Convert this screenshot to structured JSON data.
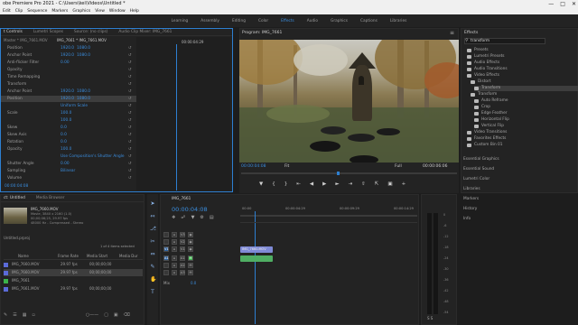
{
  "titlebar": {
    "title": "obe Premiere Pro 2021 - C:\\Users\\kei\\Videos\\Untitled *"
  },
  "menubar": {
    "items": [
      "Edit",
      "Clip",
      "Sequence",
      "Markers",
      "Graphics",
      "View",
      "Window",
      "Help"
    ]
  },
  "workspaces": {
    "items": [
      "Learning",
      "Assembly",
      "Editing",
      "Color",
      "Effects",
      "Audio",
      "Graphics",
      "Captions",
      "Libraries"
    ],
    "active": "Effects"
  },
  "effect_controls": {
    "tabs": [
      "t Controls",
      "Lumetri Scopes",
      "Source: (no clips)",
      "Audio Clip Mixer: IMG_7661"
    ],
    "master": "Master * IMG_7661.MOV",
    "seq": "IMG_7661 * IMG_7661.MOV",
    "timecode": "00:00:04:29",
    "params": [
      {
        "label": "Position",
        "v1": "1920.0",
        "v2": "1080.0"
      },
      {
        "label": "Anchor Point",
        "v1": "1920.0",
        "v2": "1080.0"
      },
      {
        "label": "Anti-flicker Filter",
        "v1": "0.00",
        "v2": ""
      },
      {
        "label": "Opacity",
        "v1": "",
        "v2": ""
      },
      {
        "label": "Time Remapping",
        "v1": "",
        "v2": ""
      },
      {
        "label": "Transform",
        "v1": "",
        "v2": ""
      },
      {
        "label": "Anchor Point",
        "v1": "1920.0",
        "v2": "1080.0"
      },
      {
        "label": "Position",
        "v1": "1920.0",
        "v2": "1080.0"
      },
      {
        "label": "",
        "v1": "Uniform Scale",
        "v2": ""
      },
      {
        "label": "Scale",
        "v1": "100.0",
        "v2": ""
      },
      {
        "label": "",
        "v1": "100.0",
        "v2": ""
      },
      {
        "label": "Skew",
        "v1": "0.0",
        "v2": ""
      },
      {
        "label": "Skew Axis",
        "v1": "0.0",
        "v2": ""
      },
      {
        "label": "Rotation",
        "v1": "0.0",
        "v2": ""
      },
      {
        "label": "Opacity",
        "v1": "100.0",
        "v2": ""
      },
      {
        "label": "",
        "v1": "Use Composition's Shutter Angle",
        "v2": ""
      },
      {
        "label": "Shutter Angle",
        "v1": "0.00",
        "v2": ""
      },
      {
        "label": "Sampling",
        "v1": "Bilinear",
        "v2": ""
      },
      {
        "label": "Volume",
        "v1": "",
        "v2": ""
      }
    ],
    "bottom_tc": "00:00:04:08"
  },
  "program": {
    "title": "Program: IMG_7661",
    "tc_in": "00:00:04:08",
    "fit": "Fit",
    "zoom": "Full",
    "tc_dur": "00:00:06:06"
  },
  "effects_panel": {
    "title": "Effects",
    "search": "transform",
    "items": [
      {
        "label": "Presets",
        "indent": 1
      },
      {
        "label": "Lumetri Presets",
        "indent": 1
      },
      {
        "label": "Audio Effects",
        "indent": 1
      },
      {
        "label": "Audio Transitions",
        "indent": 1
      },
      {
        "label": "Video Effects",
        "indent": 1
      },
      {
        "label": "Distort",
        "indent": 2
      },
      {
        "label": "Transform",
        "indent": 3,
        "selected": true
      },
      {
        "label": "Transform",
        "indent": 2
      },
      {
        "label": "Auto Reframe",
        "indent": 3
      },
      {
        "label": "Crop",
        "indent": 3
      },
      {
        "label": "Edge Feather",
        "indent": 3
      },
      {
        "label": "Horizontal Flip",
        "indent": 3
      },
      {
        "label": "Vertical Flip",
        "indent": 3
      },
      {
        "label": "Video Transitions",
        "indent": 1
      },
      {
        "label": "Favorites Effects",
        "indent": 1
      },
      {
        "label": "Custom Bin 01",
        "indent": 1
      }
    ]
  },
  "side_panels": [
    "Essential Graphics",
    "Essential Sound",
    "Lumetri Color",
    "Libraries",
    "Markers",
    "History",
    "Info"
  ],
  "project": {
    "tabs": [
      "ct: Untitled",
      "Media Browser"
    ],
    "clip_name": "IMG_7660.MOV",
    "clip_info": "Movie, 3840 x 2160 (1.0)",
    "clip_info2": "00;00;06;25, 29.97 fps",
    "clip_info3": "48000 Hz - Compressed - Stereo",
    "project_file": "Untitled.prproj",
    "selected_count": "1 of 4 items selected",
    "columns": [
      "Name",
      "Frame Rate",
      "Media Start",
      "Media Dur"
    ],
    "rows": [
      {
        "name": "IMG_7660.MOV",
        "fps": "29.97 fps",
        "start": "00;00;00;00",
        "color": "#5b6bd8"
      },
      {
        "name": "IMG_7660.MOV",
        "fps": "29.97 fps",
        "start": "00;00;00;00",
        "color": "#5b6bd8",
        "selected": true
      },
      {
        "name": "IMG_7661",
        "fps": "",
        "start": "",
        "color": "#3bb34a"
      },
      {
        "name": "IMG_7661.MOV",
        "fps": "29.97 fps",
        "start": "00;00;00;00",
        "color": "#5b6bd8"
      }
    ]
  },
  "timeline": {
    "tab": "IMG_7661",
    "timecode": "00:00:04:08",
    "ruler": [
      "00:00",
      "00:00:04:29",
      "00:00:09:29",
      "00:00:14:29"
    ],
    "tracks": [
      {
        "id": "V3",
        "kind": "video"
      },
      {
        "id": "V2",
        "kind": "video"
      },
      {
        "id": "V1",
        "kind": "video"
      },
      {
        "id": "A1",
        "kind": "audio"
      },
      {
        "id": "A2",
        "kind": "audio"
      },
      {
        "id": "A3",
        "kind": "audio"
      },
      {
        "id": "Mix",
        "kind": "mix",
        "value": "0.0"
      }
    ],
    "clips": [
      {
        "label": "IMG_7660.MOV",
        "track": "V1",
        "color": "#7f8ad6"
      },
      {
        "label": "",
        "track": "A1",
        "color": "#4fae63"
      }
    ]
  },
  "meters": {
    "scale": [
      "0",
      "-6",
      "-12",
      "-18",
      "-24",
      "-30",
      "-36",
      "-42",
      "-48",
      "-54"
    ],
    "bottom": "S S"
  }
}
